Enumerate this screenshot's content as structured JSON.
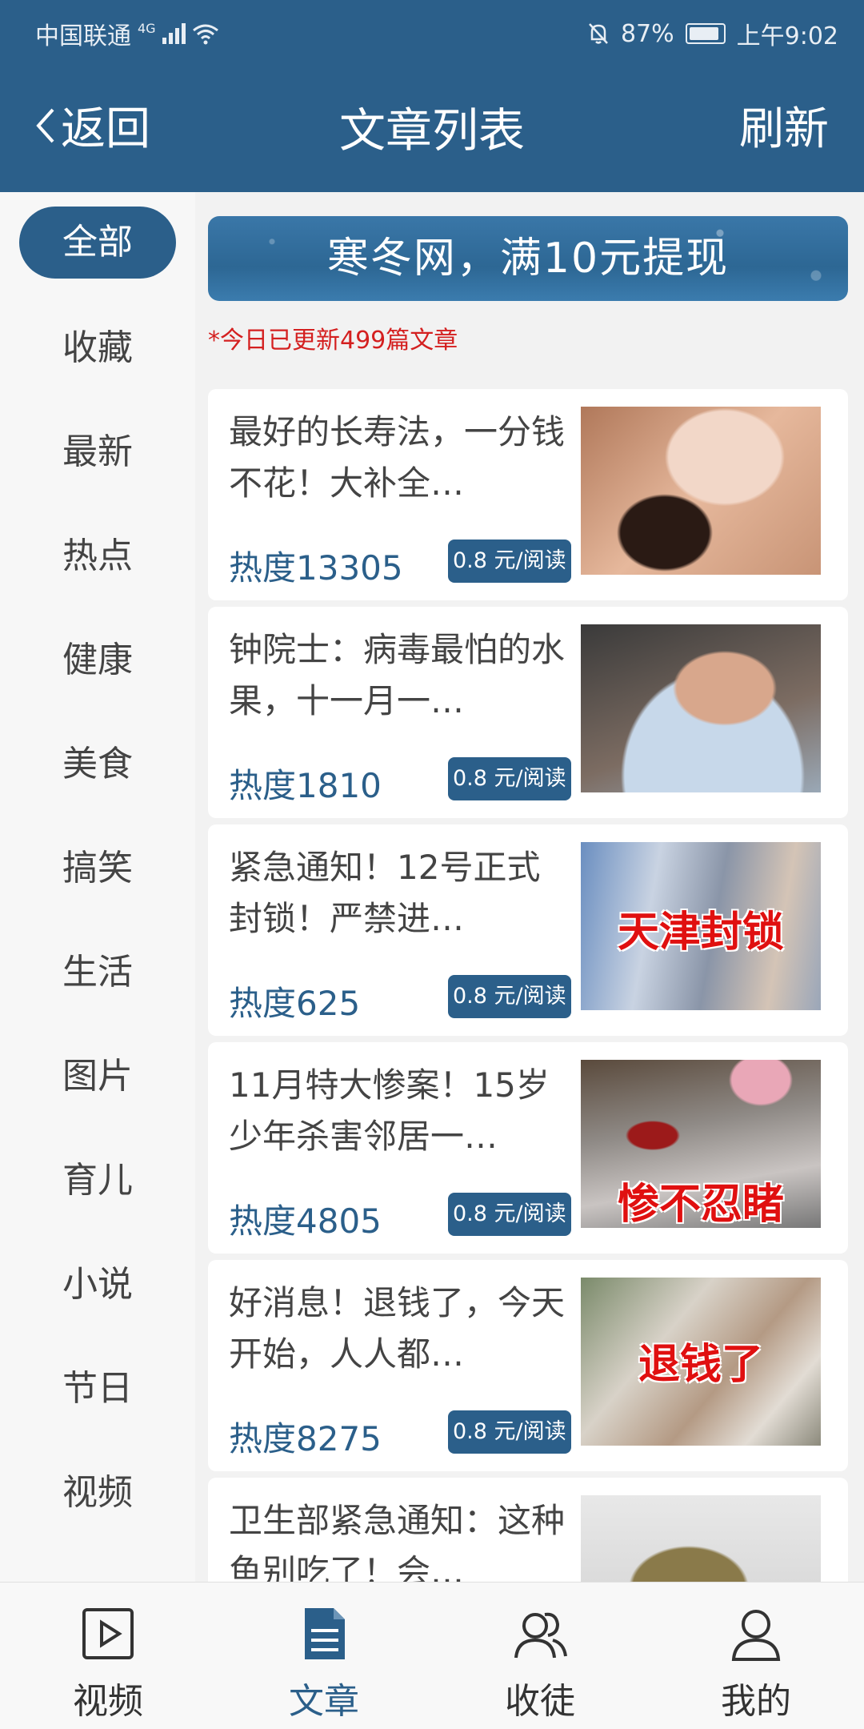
{
  "status_bar": {
    "carrier": "中国联通",
    "network": "4G",
    "battery_percent": "87%",
    "time": "上午9:02"
  },
  "nav": {
    "back_label": "返回",
    "title": "文章列表",
    "refresh_label": "刷新"
  },
  "sidebar": {
    "items": [
      {
        "label": "全部",
        "active": true
      },
      {
        "label": "收藏"
      },
      {
        "label": "最新"
      },
      {
        "label": "热点"
      },
      {
        "label": "健康"
      },
      {
        "label": "美食"
      },
      {
        "label": "搞笑"
      },
      {
        "label": "生活"
      },
      {
        "label": "图片"
      },
      {
        "label": "育儿"
      },
      {
        "label": "小说"
      },
      {
        "label": "节日"
      },
      {
        "label": "视频"
      }
    ]
  },
  "banner": {
    "text": "寒冬网，满10元提现"
  },
  "update_notice": "*今日已更新499篇文章",
  "articles": [
    {
      "title": "最好的长寿法，一分钱不花！大补全…",
      "heat": "热度13305",
      "price": "0.8 元/阅读",
      "thumb_text": ""
    },
    {
      "title": "钟院士：病毒最怕的水果，十一月一…",
      "heat": "热度1810",
      "price": "0.8 元/阅读",
      "thumb_text": ""
    },
    {
      "title": "紧急通知！12号正式封锁！严禁进…",
      "heat": "热度625",
      "price": "0.8 元/阅读",
      "thumb_text": "天津封锁"
    },
    {
      "title": "11月特大惨案！15岁少年杀害邻居一…",
      "heat": "热度4805",
      "price": "0.8 元/阅读",
      "thumb_text": "惨不忍睹"
    },
    {
      "title": "好消息！退钱了，今天开始，人人都…",
      "heat": "热度8275",
      "price": "0.8 元/阅读",
      "thumb_text": "退钱了"
    },
    {
      "title": "卫生部紧急通知：这种鱼别吃了！会…",
      "heat": "",
      "price": "",
      "thumb_text": ""
    }
  ],
  "tabbar": {
    "tabs": [
      {
        "label": "视频",
        "icon": "video-icon"
      },
      {
        "label": "文章",
        "icon": "article-icon",
        "active": true
      },
      {
        "label": "收徒",
        "icon": "users-icon"
      },
      {
        "label": "我的",
        "icon": "user-icon"
      }
    ]
  },
  "colors": {
    "primary": "#2b5f8a",
    "alert": "#d42020"
  }
}
